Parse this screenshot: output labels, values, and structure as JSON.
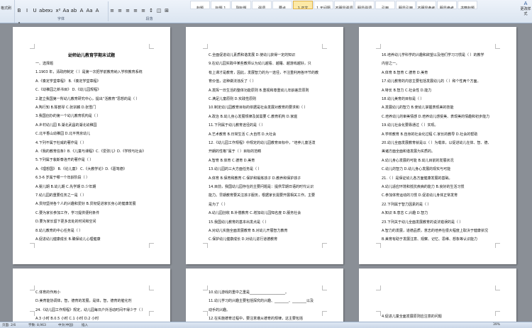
{
  "ribbon": {
    "format_painter": "格式刷",
    "font_group_label": "字体",
    "font_buttons": [
      "B",
      "I",
      "U",
      "abe",
      "x₂",
      "x²",
      "Aa",
      "ab",
      "A",
      "Aa",
      "A",
      "A"
    ],
    "paragraph_group_label": "段落",
    "paragraph_buttons": [
      "≡",
      "≡",
      "≡",
      "≡",
      "≡",
      "↕",
      "◫",
      "⊞"
    ],
    "styles": [
      {
        "label": "标题",
        "active": false
      },
      {
        "label": "标题 1",
        "active": false
      },
      {
        "label": "副标题",
        "active": false
      },
      {
        "label": "强调",
        "active": false
      },
      {
        "label": "要点",
        "active": false
      },
      {
        "label": "1 正文",
        "active": true
      },
      {
        "label": "1 无间隔",
        "active": false
      },
      {
        "label": "不明显强调",
        "active": false
      },
      {
        "label": "明显强调",
        "active": false
      },
      {
        "label": "引用",
        "active": false
      },
      {
        "label": "明显引用",
        "active": false
      },
      {
        "label": "不明显参考",
        "active": false
      },
      {
        "label": "明显参考",
        "active": false
      },
      {
        "label": "书籍标题",
        "active": false
      }
    ],
    "change_styles": "更改样式"
  },
  "pages": [
    {
      "title": "幼师幼儿教育学期末试题",
      "lines": [
        "一、选择题",
        "1.1903 年，清政府制定（    ）是第一次把学前教育纳入学校教育系统",
        "A.《奏定学堂章程》       B.《奏定学堂章程》",
        "C.《幼稚园之新书目》     D.《幼儿园规程》",
        "2.建立我国第一所幼儿教育研究中心，提出“活教育”思想的是（    ）",
        "A.陶行知          B.陈鹤琴          C.张宗麟          D.张雪门",
        "3.我国创办的第一个幼儿教育机构是（    ）",
        "A.乡村幼儿园                      B.湖北武昌的湖北幼稚园",
        "C.北平香山幼稚园                  D.北平燕京幼儿",
        "4.下列不属于杜威的著作是（    ）",
        "A.《我的教育信条》B.《儿童与课程》C.《爱弥儿》D.《学校与社会》",
        "5.下列属于裴斯泰洛齐的著作是（    ）",
        "A.《理想国》 B.《论儿童》 C.《大教学论》D.《葛笃德》",
        "6.3-6 岁属于哪一个年龄阶段（    ）",
        "A.婴儿期         B.幼儿期         C.先学期         D.少年期",
        "7.幼儿园的重要任务之一是（    ）",
        "A.贯彻坚持各个人的兴趣和爱好       B.贯彻促进家长身心的健康发展",
        "C.要为家长参加工作，学习提供便利条件",
        "D.要为家长留下更多去处的时间和空间",
        "8.幼儿教育的中心任务是（    ）",
        "A.促进幼儿健康成长                B.确保幼儿心理健康"
      ]
    },
    {
      "title": "",
      "lines": [
        "C.全面促进幼儿素质和谐发展            D.使幼儿获得一定的知识",
        "9.在幼儿园实践中某些教师认为幼儿越看、越睡、越游戏越好，只",
        "有上课才是教育，因此，发展智力的为一途径，不注重利用各环节的教",
        "育价值，这种做法违反了（    ）",
        "A.发挥一日生活的整体功能原则           B.重视和尊重幼儿年龄差异原则",
        "C.满足儿童原则                        D.实践性原则",
        "10.制定幼儿园教育目标的依据是社会发展对教育的要求和（    ）",
        "A.政治      B.幼儿身心发展规律及其需要      C.教育机构      D.家庭",
        "11.下列属于幼儿教育途径的是（    ）",
        "A.艺术教育        B.日常生活         C.大自然          D.大社会",
        "12.《幼儿园工作规程》中规定的幼儿园教育目标中，“培养儿童活泼",
        "开朗的性格”属于（    ）目标的范畴",
        "A.智育         B.体育         C.德育         D.美育",
        "13.幼儿园的三大方面任务是（    ）",
        "A.体育  B.保育和教育  C.保护和锻炼孩子  D.教养和保护孩子",
        "14.目前，我国幼儿园存在的主要问题是：提供早期日语的时代认识",
        "能力。早期教育要关注孩子服务，根据家长需要开展相关工作。主要",
        "是为了（    ）",
        "A.幼儿园创收    B.补偿教育    C.增加幼儿园知名度    D.服务社会",
        "15.我国幼儿教育的基本出发点是（    ）",
        "A.对幼儿实施全面发展教育            B.对幼儿开展智力教育",
        "C.保护幼儿健康成长                  D.对幼儿进行道德教育"
      ]
    },
    {
      "title": "",
      "lines": [
        "16.培养幼儿学科学的兴趣和欲望以及他们学习习惯是（    ）的教学",
        "内容之一。",
        "A.体育            B.智育              C.德育              D.美育",
        "17.幼儿教育的内容主要包括发展幼儿的（    ）和个性两个方面。",
        "A.特长            B.智力              C.社会性            D.能力",
        "18.幼儿美育的目标是（    ）",
        "A.发展幼儿的智力               B.使幼儿掌握表现美的技能",
        "C.培养幼儿的审美情感   D.培养幼儿感受美、表现美的情趣和初步能力",
        "19.幼儿社会化要靠通过（    ）实现。",
        "A.学校教育    B.自身的社会化过程    C.家长的教导    D.社会的帮助",
        "20.幼儿全面发展教育就是以（    ）为载体，以促进幼儿在体、智、德、",
        "美诸方面全面和谐发展为实质的。",
        "A.幼儿身心发展的可能              B.幼儿目前的发展状况",
        "C.幼儿的智力                      D.幼儿身心发展的现实与可能",
        "21.（    ）是保证幼儿各方面健康发展的基础。",
        "A.幼儿适应环境和抵抗疾病的能力      B.良好的生活习惯",
        "C.参加体育运动的习惯               D.促进幼儿身体正常发育",
        "22.下列属于智力因素的是（    ）",
        "A.知识            B.意志            C.兴趣            D.智力",
        "23.下列关于幼儿全面发展教育的说法错误的是（    ）",
        "A.智力的发展，道德品质，意志的培养在很大程度上取决于健康状况",
        "B.美育有助于发展注意、观察、记忆、思维、想象等认识能力"
      ]
    },
    {
      "lines": [
        "C.体育的作用小",
        "D.美育能协调体，智，德育的发展，是体，智，德育的催化剂",
        "24.《幼儿园工作规程》规定，幼儿园每日户外活动时间不得少于（    ）",
        "A.3 小时          B.0.5 小时          C.1 小时          D.2 小时"
      ]
    },
    {
      "lines": [
        "10.幼儿游戏的重中之重是____________________。",
        "11.幼儿学习的兴趣主要包括探究的兴趣、________、________以及",
        "动手的兴趣。",
        "12.在实施德育过程中，要注意遵从德育的规律，这主要包括"
      ]
    },
    {
      "lines": [
        "4.促进儿童全面发展原则应注意的问题"
      ]
    }
  ],
  "status": {
    "page": "页面: 2/6",
    "words": "字数: 8,963",
    "language": "中文(中国)",
    "mode": "插入",
    "zoom": "39%"
  }
}
